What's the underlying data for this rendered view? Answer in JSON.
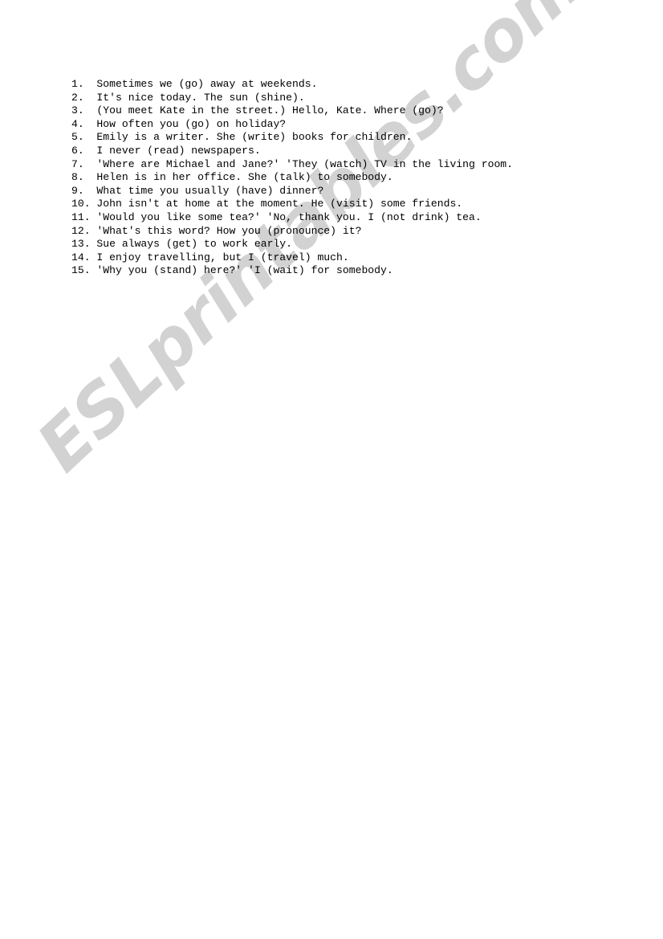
{
  "document": {
    "type": "worksheet",
    "background_color": "#ffffff",
    "text_color": "#000000"
  },
  "watermark": {
    "text": "ESLprintables.com",
    "color": "#d2d2d2",
    "rotation_degrees": -43
  },
  "exercise": {
    "lines": [
      "1.  Sometimes we (go) away at weekends.",
      "2.  It's nice today. The sun (shine).",
      "3.  (You meet Kate in the street.) Hello, Kate. Where (go)?",
      "4.  How often you (go) on holiday?",
      "5.  Emily is a writer. She (write) books for children.",
      "6.  I never (read) newspapers.",
      "7.  'Where are Michael and Jane?' 'They (watch) TV in the living room.",
      "8.  Helen is in her office. She (talk) to somebody.",
      "9.  What time you usually (have) dinner?",
      "10. John isn't at home at the moment. He (visit) some friends.",
      "11. 'Would you like some tea?' 'No, thank you. I (not drink) tea.",
      "12. 'What's this word? How you (pronounce) it?",
      "13. Sue always (get) to work early.",
      "14. I enjoy travelling, but I (travel) much.",
      "15. 'Why you (stand) here?' 'I (wait) for somebody."
    ]
  }
}
